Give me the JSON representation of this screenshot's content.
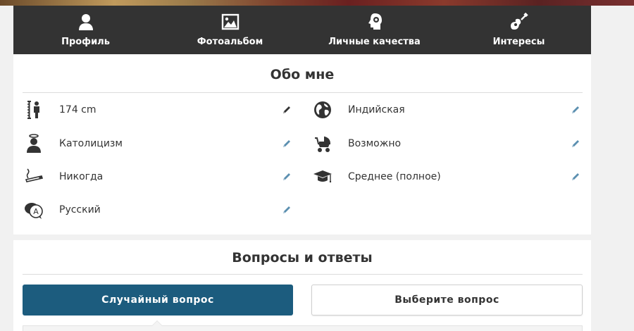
{
  "nav": {
    "items": [
      {
        "label": "Профиль",
        "icon": "user-icon"
      },
      {
        "label": "Фотоальбом",
        "icon": "picture-icon"
      },
      {
        "label": "Личные качества",
        "icon": "head-gear-icon"
      },
      {
        "label": "Интересы",
        "icon": "guitar-icon"
      }
    ]
  },
  "about": {
    "title": "Обо мне",
    "attributes": [
      {
        "label": "174 cm",
        "icon": "height-icon"
      },
      {
        "label": "Индийская",
        "icon": "globe-icon"
      },
      {
        "label": "Католицизм",
        "icon": "religion-icon"
      },
      {
        "label": "Возможно",
        "icon": "stroller-icon"
      },
      {
        "label": "Никогда",
        "icon": "cigarette-icon"
      },
      {
        "label": "Среднее (полное)",
        "icon": "graduation-cap-icon"
      },
      {
        "label": "Русский",
        "icon": "language-bubble-icon"
      }
    ]
  },
  "qa": {
    "title": "Вопросы и ответы",
    "random_button": "Случайный вопрос",
    "choose_button": "Выберите вопрос"
  },
  "colors": {
    "nav_bg": "#333333",
    "primary_button": "#1c5c7e",
    "edit_icon": "#5b8fb0"
  }
}
